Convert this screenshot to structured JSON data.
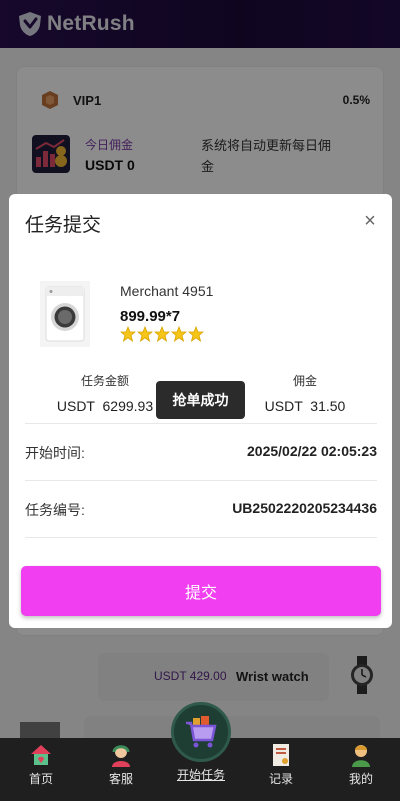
{
  "header": {
    "brand": "NetRush"
  },
  "vip_card": {
    "level": "VIP1",
    "rate": "0.5%",
    "commission_title": "今日佣金",
    "commission_value": "USDT 0",
    "note": "系统将自动更新每日佣金"
  },
  "task_list": [
    {
      "price": "USDT 429.00",
      "name": "Wrist watch"
    }
  ],
  "modal": {
    "title": "任务提交",
    "close": "×",
    "product": {
      "merchant": "Merchant 4951",
      "price": "899.99*7",
      "rating": 5
    },
    "task_amount_label": "任务金额",
    "task_amount_value": "USDT  6299.93",
    "commission_label": "佣金",
    "commission_value": "USDT  31.50",
    "toast": "抢单成功",
    "start_time_label": "开始时间:",
    "start_time_value": "2025/02/22 02:05:23",
    "task_no_label": "任务编号:",
    "task_no_value": "UB2502220205234436",
    "submit": "提交"
  },
  "bottom_nav": {
    "home": "首页",
    "service": "客服",
    "start_task": "开始任务",
    "records": "记录",
    "mine": "我的"
  },
  "colors": {
    "header": "#1c0a3a",
    "submit_button": "#f03ef0",
    "commission_title": "#7a3aa6",
    "nav_bar": "#1f1f1f",
    "star": "#f5c518"
  },
  "icons": [
    "shield-logo-icon",
    "vip-badge-icon",
    "commission-chart-icon",
    "washing-machine-image",
    "star-icon",
    "close-icon",
    "watch-image",
    "home-icon",
    "service-icon",
    "cart-icon",
    "records-icon",
    "mine-icon"
  ]
}
